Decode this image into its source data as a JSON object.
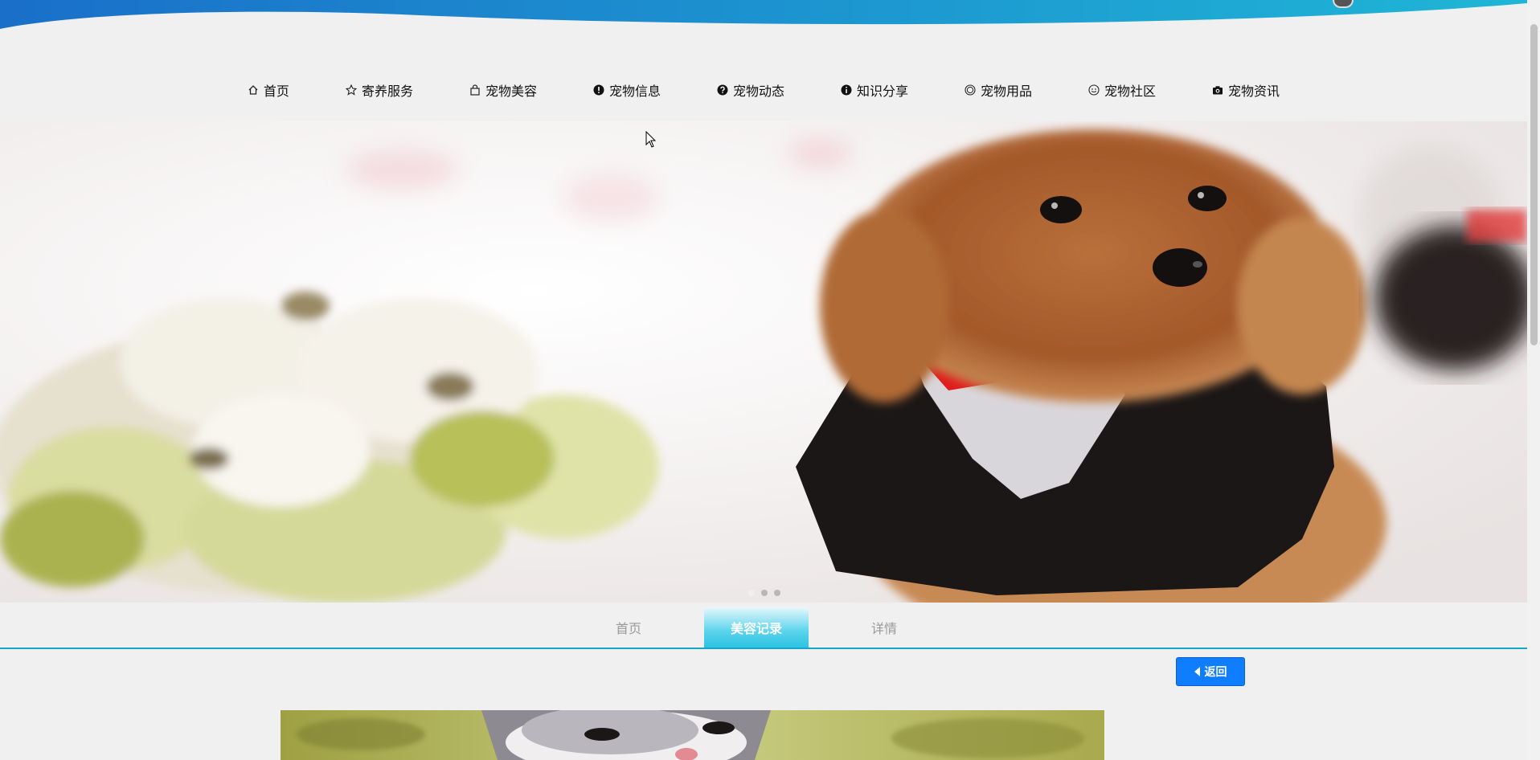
{
  "colors": {
    "header_blue": "#1a6fc9",
    "header_cyan": "#1fb6d6",
    "tab_line": "#16a6c9",
    "back_button": "#0f7dff"
  },
  "nav": {
    "items": [
      {
        "label": "首页",
        "icon": "home-icon"
      },
      {
        "label": "寄养服务",
        "icon": "star-icon"
      },
      {
        "label": "宠物美容",
        "icon": "bag-icon"
      },
      {
        "label": "宠物信息",
        "icon": "alert-circle-icon"
      },
      {
        "label": "宠物动态",
        "icon": "question-circle-icon"
      },
      {
        "label": "知识分享",
        "icon": "info-circle-icon"
      },
      {
        "label": "宠物用品",
        "icon": "smile-icon"
      },
      {
        "label": "宠物社区",
        "icon": "meh-icon"
      },
      {
        "label": "宠物资讯",
        "icon": "camera-icon"
      }
    ]
  },
  "banner": {
    "image": "poodle-in-tuxedo-photo",
    "slide_count": 3,
    "active_slide": 1
  },
  "breadcrumb": {
    "tabs": [
      {
        "label": "首页",
        "active": false
      },
      {
        "label": "美容记录",
        "active": true
      },
      {
        "label": "详情",
        "active": false
      }
    ]
  },
  "actions": {
    "back_label": "返回"
  },
  "detail": {
    "image": "cat-on-grass-photo"
  }
}
